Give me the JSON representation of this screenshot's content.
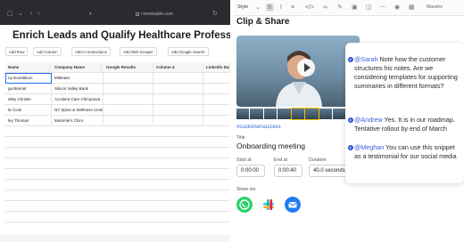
{
  "browser": {
    "url": "coredouble.com"
  },
  "sheet": {
    "title": "Enrich Leads and Qualify Healthcare Professionals",
    "toolbar": [
      "Add Row",
      "Add Column",
      "Add AI Instructions",
      "Add Web Scraper",
      "Add Google Search"
    ],
    "columns": [
      "Name",
      "Company Name",
      "Google Results",
      "Column 4",
      "Linkedin Data"
    ],
    "rows": [
      [
        "ny Donaldson",
        "MrBeast"
      ],
      [
        "ga Bennet",
        "Silicon Valley Bank"
      ],
      [
        "elley Christie",
        "Accident Care Chiropracti..."
      ],
      [
        "la Cook",
        "NY Spine & Wellness Center"
      ],
      [
        "ley Thomas",
        "Mommie's Chiro"
      ]
    ]
  },
  "clip": {
    "toolbar_style": "Style",
    "toolbar_badge": "Maestro",
    "title": "Clip & Share",
    "hashtag": "#customersuccess",
    "title_label": "Title",
    "title_value": "Onboarding meeting",
    "start_label": "Start at",
    "start_value": "0:00:00",
    "end_label": "End at",
    "end_value": "0:00:40",
    "duration_label": "Duration",
    "duration_value": "40.0 seconds",
    "share_label": "Share via",
    "share_targets": [
      "whatsapp-icon",
      "slack-icon",
      "mail-icon"
    ]
  },
  "comments": [
    {
      "mention": "@Sarah",
      "text": " Note how the customer structures his notes. Are we considering templates for supporting summaries in different formats?"
    },
    {
      "mention": "@Andrew",
      "text": " Yes. It is in our roadmap. Tentative rollout by end of March"
    },
    {
      "mention": "@Meghan",
      "text": " You can use this snippet as a testimonial for our social media"
    }
  ],
  "colors": {
    "accent": "#3b5bd9",
    "whatsapp": "#25d366",
    "mail": "#1e7cf2",
    "chrome": "#2b2b2f"
  }
}
